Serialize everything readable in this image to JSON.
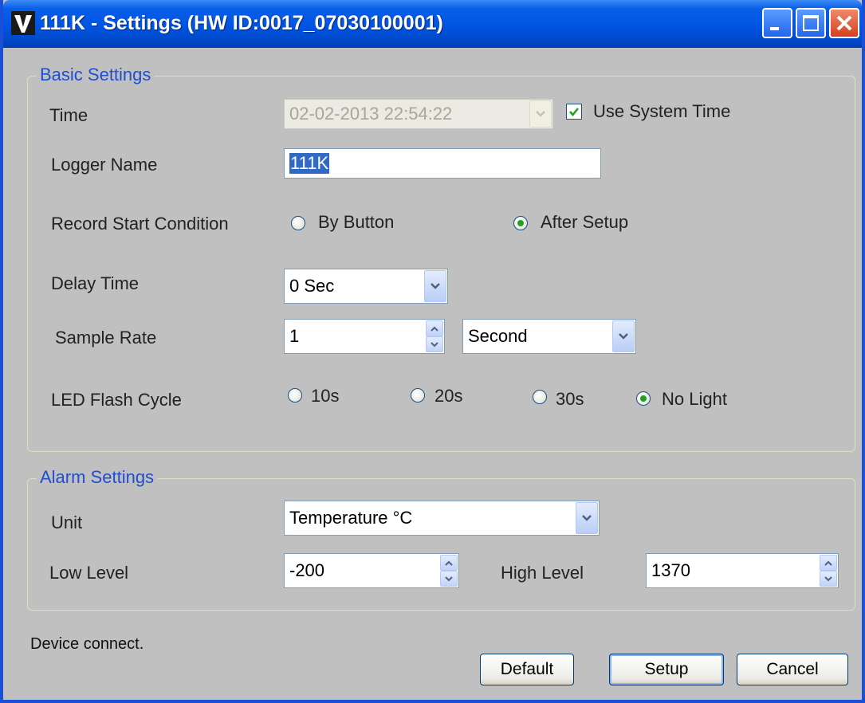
{
  "window": {
    "title": "111K - Settings (HW ID:0017_07030100001)"
  },
  "basic": {
    "group_title": "Basic Settings",
    "time_label": "Time",
    "time_value": "02-02-2013 22:54:22",
    "use_system_time_label": "Use System Time",
    "use_system_time_checked": true,
    "logger_name_label": "Logger Name",
    "logger_name_value": "111K",
    "record_start_label": "Record Start Condition",
    "record_start_options": [
      "By Button",
      "After Setup"
    ],
    "record_start_selected": "After Setup",
    "delay_time_label": "Delay Time",
    "delay_time_value": "0 Sec",
    "sample_rate_label": "Sample Rate",
    "sample_rate_value": "1",
    "sample_rate_unit": "Second",
    "led_flash_label": "LED Flash Cycle",
    "led_flash_options": [
      "10s",
      "20s",
      "30s",
      "No Light"
    ],
    "led_flash_selected": "No Light"
  },
  "alarm": {
    "group_title": "Alarm Settings",
    "unit_label": "Unit",
    "unit_value": "Temperature °C",
    "low_level_label": "Low Level",
    "low_level_value": "-200",
    "high_level_label": "High Level",
    "high_level_value": "1370"
  },
  "status_text": "Device connect.",
  "buttons": {
    "default_label": "Default",
    "setup_label": "Setup",
    "cancel_label": "Cancel"
  },
  "colors": {
    "titlebar": "#0054e3",
    "group_title": "#1f4fd0",
    "selection": "#316ac5",
    "radio_dot": "#21a121"
  }
}
